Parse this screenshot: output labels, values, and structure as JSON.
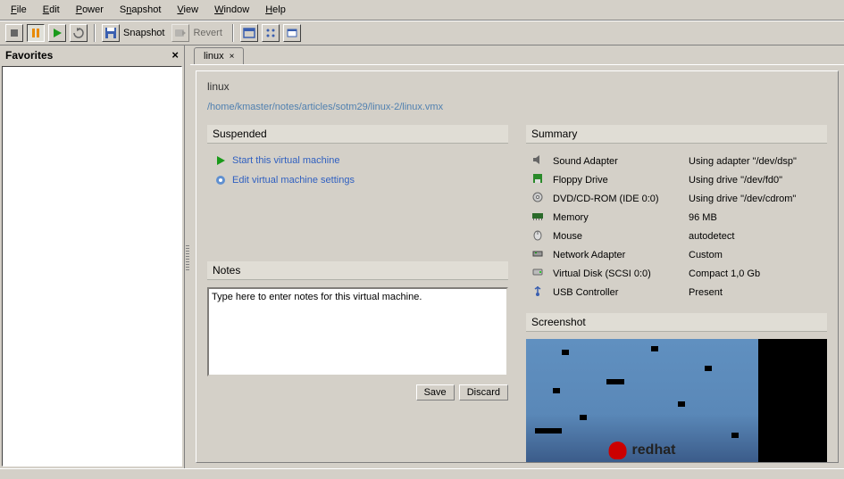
{
  "menu": {
    "items": [
      "File",
      "Edit",
      "Power",
      "Snapshot",
      "View",
      "Window",
      "Help"
    ]
  },
  "toolbar": {
    "snapshot_label": "Snapshot",
    "revert_label": "Revert"
  },
  "favorites": {
    "title": "Favorites"
  },
  "tab": {
    "label": "linux"
  },
  "vm": {
    "title": "linux",
    "path": "/home/kmaster/notes/articles/sotm29/linux-2/linux.vmx"
  },
  "sections": {
    "suspended": "Suspended",
    "summary": "Summary",
    "notes": "Notes",
    "screenshot": "Screenshot"
  },
  "actions": {
    "start": "Start this virtual machine",
    "edit": "Edit virtual machine settings"
  },
  "summary": [
    {
      "icon": "sound",
      "name": "Sound Adapter",
      "value": "Using adapter \"/dev/dsp\""
    },
    {
      "icon": "floppy",
      "name": "Floppy Drive",
      "value": "Using drive \"/dev/fd0\""
    },
    {
      "icon": "cdrom",
      "name": "DVD/CD-ROM (IDE 0:0)",
      "value": "Using drive \"/dev/cdrom\""
    },
    {
      "icon": "memory",
      "name": "Memory",
      "value": "96 MB"
    },
    {
      "icon": "mouse",
      "name": "Mouse",
      "value": "autodetect"
    },
    {
      "icon": "network",
      "name": "Network Adapter",
      "value": "Custom"
    },
    {
      "icon": "disk",
      "name": "Virtual Disk (SCSI 0:0)",
      "value": "Compact 1,0 Gb"
    },
    {
      "icon": "usb",
      "name": "USB Controller",
      "value": "Present"
    }
  ],
  "notes": {
    "placeholder": "Type here to enter notes for this virtual machine.",
    "save": "Save",
    "discard": "Discard"
  },
  "screenshot": {
    "brand": "redhat"
  }
}
